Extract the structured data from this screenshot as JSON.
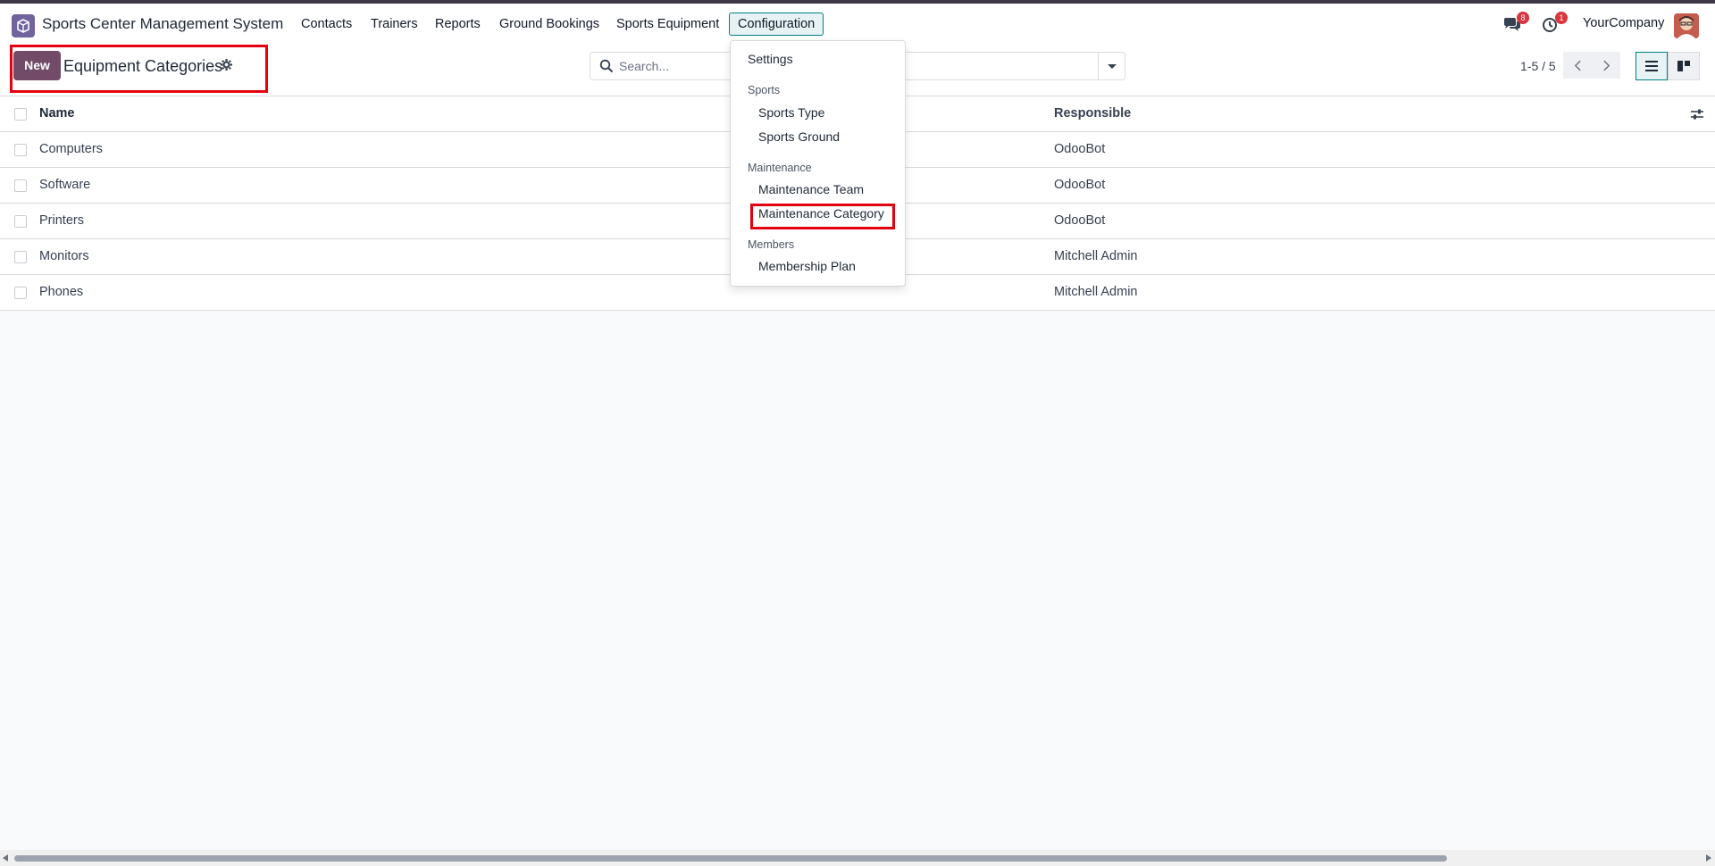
{
  "app": {
    "brand": "Sports Center Management System",
    "company": "YourCompany"
  },
  "nav": {
    "items": [
      "Contacts",
      "Trainers",
      "Reports",
      "Ground Bookings",
      "Sports Equipment",
      "Configuration"
    ],
    "messages_count": "8",
    "activities_count": "1"
  },
  "control_panel": {
    "new_label": "New",
    "title": "Equipment Categories",
    "search_placeholder": "Search...",
    "pager": "1-5 / 5"
  },
  "list": {
    "columns": {
      "name": "Name",
      "responsible": "Responsible"
    },
    "rows": [
      {
        "name": "Computers",
        "responsible": "OdooBot"
      },
      {
        "name": "Software",
        "responsible": "OdooBot"
      },
      {
        "name": "Printers",
        "responsible": "OdooBot"
      },
      {
        "name": "Monitors",
        "responsible": "Mitchell Admin"
      },
      {
        "name": "Phones",
        "responsible": "Mitchell Admin"
      }
    ]
  },
  "config_menu": {
    "settings": "Settings",
    "sports_section": "Sports",
    "sports_type": "Sports Type",
    "sports_ground": "Sports Ground",
    "maintenance_section": "Maintenance",
    "maintenance_team": "Maintenance Team",
    "maintenance_category": "Maintenance Category",
    "members_section": "Members",
    "membership_plan": "Membership Plan"
  },
  "colors": {
    "brand_primary": "#714b67",
    "active_teal": "#017e84",
    "highlight_red": "#e3000f"
  }
}
